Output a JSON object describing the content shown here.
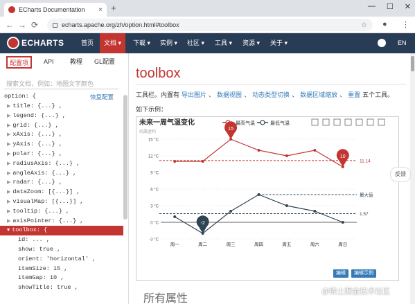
{
  "browser": {
    "tab_title": "ECharts Documentation",
    "tab_close": "×",
    "new_tab": "+",
    "window_controls": [
      "—",
      "☐",
      "✕"
    ],
    "url": "echarts.apache.org/zh/option.html#toolbox",
    "back": "←",
    "forward": "→",
    "reload": "⟳",
    "star": "☆",
    "menu": "⋮"
  },
  "nav": {
    "logo_text": "ECHARTS",
    "items": [
      "首页",
      "文档 ▾",
      "下载 ▾",
      "实例 ▾",
      "社区 ▾",
      "工具 ▾",
      "资源 ▾",
      "关于 ▾"
    ],
    "active_index": 1,
    "lang": "EN"
  },
  "sidebar": {
    "tabs": [
      "配置项",
      "API",
      "教程",
      "GL配置"
    ],
    "search_placeholder": "搜索文档，例如：地图文字颜色",
    "root": "option: {",
    "reset": "恢复配置",
    "tree": [
      {
        "text": "title: {...} ,",
        "sel": false,
        "child": false
      },
      {
        "text": "legend: {...} ,",
        "sel": false,
        "child": false
      },
      {
        "text": "grid: {...} ,",
        "sel": false,
        "child": false
      },
      {
        "text": "xAxis: {...} ,",
        "sel": false,
        "child": false
      },
      {
        "text": "yAxis: {...} ,",
        "sel": false,
        "child": false
      },
      {
        "text": "polar: {...} ,",
        "sel": false,
        "child": false
      },
      {
        "text": "radiusAxis: {...} ,",
        "sel": false,
        "child": false
      },
      {
        "text": "angleAxis: {...} ,",
        "sel": false,
        "child": false
      },
      {
        "text": "radar: {...} ,",
        "sel": false,
        "child": false
      },
      {
        "text": "dataZoom: [{...}] ,",
        "sel": false,
        "child": false
      },
      {
        "text": "visualMap: [{...}] ,",
        "sel": false,
        "child": false
      },
      {
        "text": "tooltip: {...} ,",
        "sel": false,
        "child": false
      },
      {
        "text": "axisPointer: {...} ,",
        "sel": false,
        "child": false
      },
      {
        "text": "toolbox: {",
        "sel": true,
        "child": false
      },
      {
        "text": "id: ... ,",
        "sel": false,
        "child": true
      },
      {
        "text": "show: true ,",
        "sel": false,
        "child": true
      },
      {
        "text": "orient: 'horizontal' ,",
        "sel": false,
        "child": true
      },
      {
        "text": "itemSize: 15 ,",
        "sel": false,
        "child": true
      },
      {
        "text": "itemGap: 10 ,",
        "sel": false,
        "child": true
      },
      {
        "text": "showTitle: true ,",
        "sel": false,
        "child": true
      }
    ]
  },
  "main": {
    "title": "toolbox",
    "desc_prefix": "工具栏。内置有",
    "desc_links": [
      "导出图片",
      "数据视图",
      "动态类型切换",
      "数据区域缩放",
      "重置"
    ],
    "desc_suffix": "五个工具。",
    "example_label": "如下示例：",
    "section_title": "所有属性",
    "feedback": "反馈",
    "chart_buttons": [
      "编辑",
      "编辑示例"
    ]
  },
  "watermark": "@稀土掘金技术社区",
  "chart_data": {
    "type": "line",
    "title": "未来一周气温变化",
    "subtitle": "纯属虚构",
    "categories": [
      "周一",
      "周二",
      "周三",
      "周四",
      "周五",
      "周六",
      "周日"
    ],
    "series": [
      {
        "name": "最高气温",
        "values": [
          11,
          11,
          15,
          13,
          12,
          13,
          10
        ],
        "color": "#c23531",
        "markPoint": {
          "max": "15",
          "min": "10"
        },
        "markLine": {
          "label": "11.14",
          "value": 11.14
        }
      },
      {
        "name": "最低气温",
        "values": [
          1,
          -2,
          2,
          5,
          3,
          2,
          0
        ],
        "color": "#2f4554",
        "markPoint": {
          "min": "-2"
        },
        "markLine": [
          {
            "label": "1.57",
            "value": 1.57
          },
          {
            "label": "最大值",
            "value": 5
          }
        ]
      }
    ],
    "yticks": [
      "15 °C",
      "12 °C",
      "9 °C",
      "6 °C",
      "3 °C",
      "0 °C",
      "-3 °C"
    ],
    "ylim": [
      -3,
      15
    ],
    "legend_position": "top-center",
    "toolbox_icons": [
      "data-zoom-icon",
      "zoom-reset-icon",
      "data-view-icon",
      "line-type-icon",
      "bar-type-icon",
      "restore-icon",
      "download-icon"
    ]
  }
}
